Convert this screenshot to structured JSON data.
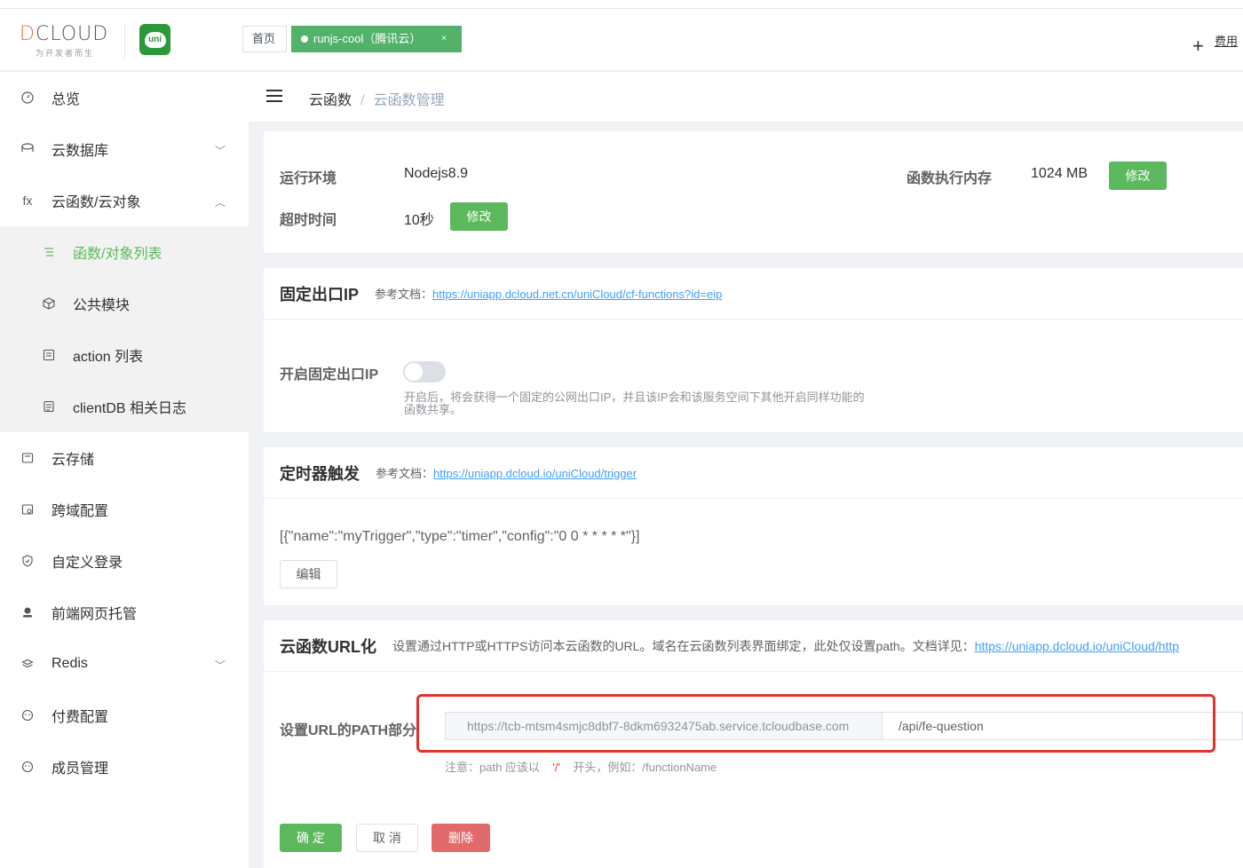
{
  "header": {
    "logo_text_d": "D",
    "logo_text_rest": "CLOUD",
    "logo_sub": "为开发者而生",
    "uni_icon": "uni",
    "tabs": [
      {
        "label": "首页"
      },
      {
        "label": "runjs-cool（腾讯云）",
        "close": "×"
      }
    ],
    "plus": "+",
    "link": "费用"
  },
  "sidebar": {
    "items": [
      {
        "label": "总览",
        "icon": "dashboard-icon"
      },
      {
        "label": "云数据库",
        "icon": "database-icon",
        "arrow": "﹀"
      },
      {
        "label": "云函数/云对象",
        "icon": "fx-icon",
        "icon_text": "fx",
        "arrow": "︿"
      },
      {
        "label": "云存储",
        "icon": "storage-icon"
      },
      {
        "label": "跨域配置",
        "icon": "cors-icon"
      },
      {
        "label": "自定义登录",
        "icon": "shield-icon"
      },
      {
        "label": "前端网页托管",
        "icon": "hosting-icon"
      },
      {
        "label": "Redis",
        "icon": "redis-icon",
        "arrow": "﹀"
      },
      {
        "label": "付费配置",
        "icon": "payment-icon"
      },
      {
        "label": "成员管理",
        "icon": "members-icon"
      }
    ],
    "submenu": [
      {
        "label": "函数/对象列表",
        "icon": "list-icon"
      },
      {
        "label": "公共模块",
        "icon": "cube-icon"
      },
      {
        "label": "action 列表",
        "icon": "action-icon"
      },
      {
        "label": "clientDB 相关日志",
        "icon": "log-icon"
      }
    ]
  },
  "breadcrumb": {
    "first": "云函数",
    "sep": "/",
    "current": "云函数管理"
  },
  "runtime": {
    "env_label": "运行环境",
    "env_value": "Nodejs8.9",
    "memory_label": "函数执行内存",
    "memory_value": "1024 MB",
    "memory_edit": "修改",
    "timeout_label": "超时时间",
    "timeout_value": "10秒",
    "timeout_edit": "修改"
  },
  "fixed_ip": {
    "title": "固定出口IP",
    "ref_label": "参考文档：",
    "ref_link": "https://uniapp.dcloud.net.cn/uniCloud/cf-functions?id=eip",
    "switch_label": "开启固定出口IP",
    "hint_line1": "开启后，将会获得一个固定的公网出口IP，并且该IP会和该服务空间下其他开启同样功能的",
    "hint_line2": "函数共享。"
  },
  "timer": {
    "title": "定时器触发",
    "ref_label": "参考文档：",
    "ref_link": "https://uniapp.dcloud.io/uniCloud/trigger",
    "config": "[{\"name\":\"myTrigger\",\"type\":\"timer\",\"config\":\"0 0 * * * * *\"}]",
    "edit": "编辑"
  },
  "url": {
    "title": "云函数URL化",
    "desc": "设置通过HTTP或HTTPS访问本云函数的URL。域名在云函数列表界面绑定，此处仅设置path。文档详见：",
    "desc_link": "https://uniapp.dcloud.io/uniCloud/http",
    "path_label": "设置URL的PATH部分",
    "prepend": "https://tcb-mtsm4smjc8dbf7-8dkm6932475ab.service.tcloudbase.com",
    "path_value": "/api/fe-question",
    "note_prefix": "注意：path 应该以",
    "note_quote": "'/'",
    "note_suffix": "开头，例如：/functionName",
    "confirm": "确 定",
    "cancel": "取 消",
    "delete": "删除"
  }
}
